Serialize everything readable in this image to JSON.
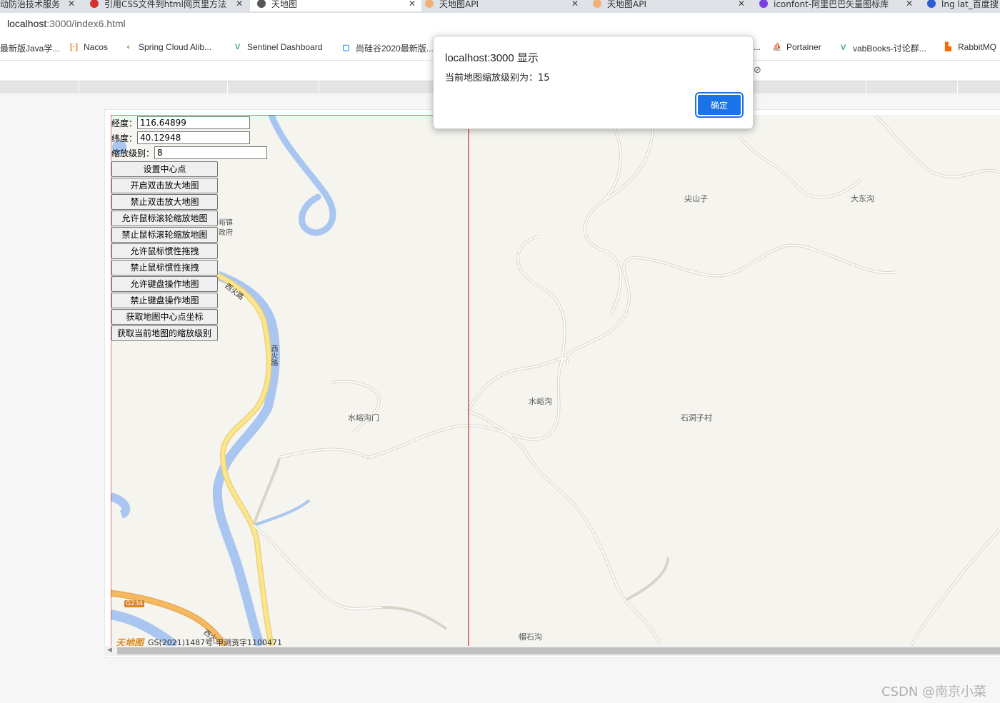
{
  "browser": {
    "tabs": [
      {
        "title": "动防治技术服务",
        "active": false,
        "color": "#c0392b"
      },
      {
        "title": "引用CSS文件到html网页里方法",
        "active": false,
        "color": "#d63031"
      },
      {
        "title": "天地图",
        "active": true,
        "color": "#555555"
      },
      {
        "title": "天地图API",
        "active": false,
        "color": "#e67e22"
      },
      {
        "title": "天地图API",
        "active": false,
        "color": "#e67e22"
      },
      {
        "title": "iconfont-阿里巴巴矢量图标库",
        "active": false,
        "color": "#7b3fe4"
      },
      {
        "title": "lng lat_百度搜",
        "active": false,
        "color": "#2d5bd7"
      }
    ],
    "url_host": "localhost",
    "url_path": ":3000/index6.html",
    "bookmarks": [
      {
        "label": "最新版Java学...",
        "icon": "",
        "color": "#888"
      },
      {
        "label": "Nacos",
        "icon": "[·]",
        "color": "#e67e22"
      },
      {
        "label": "Spring Cloud Alib...",
        "icon": "◐",
        "color": "#6db33f"
      },
      {
        "label": "Sentinel Dashboard",
        "icon": "V",
        "color": "#3aa876"
      },
      {
        "label": "尚硅谷2020最新版...",
        "icon": "▢",
        "color": "#1e90ff"
      },
      {
        "label": "...",
        "icon": "",
        "color": "#888"
      },
      {
        "label": "Portainer",
        "icon": "⛵",
        "color": "#13bef9"
      },
      {
        "label": "vabBooks-讨论群...",
        "icon": "V",
        "color": "#3aa876"
      },
      {
        "label": "RabbitMQ",
        "icon": "▙",
        "color": "#ff6600"
      }
    ]
  },
  "controls": {
    "lng_label": "经度：",
    "lng_value": "116.64899",
    "lat_label": "纬度：",
    "lat_value": "40.12948",
    "zoom_label": "缩放级别：",
    "zoom_value": "8",
    "buttons": [
      "设置中心点",
      "开启双击放大地图",
      "禁止双击放大地图",
      "允许鼠标滚轮缩放地图",
      "禁止鼠标滚轮缩放地图",
      "允许鼠标惯性拖拽",
      "禁止鼠标惯性拖拽",
      "允许键盘操作地图",
      "禁止键盘操作地图",
      "获取地图中心点坐标",
      "获取当前地图的缩放级别"
    ]
  },
  "map": {
    "places": {
      "jianshanzi": "尖山子",
      "dadonggou": "大东沟",
      "shuiyugou": "水峪沟",
      "shidongzicun": "石洞子村",
      "shuiyugoumen": "水峪沟门",
      "maoshigou": "帽石沟",
      "town_partial_1": "峪镇",
      "town_partial_2": "政府"
    },
    "roads": {
      "xihuo_1": "西火路",
      "xihuo_2": "西火路",
      "g234": "G234",
      "xihuo_3": "西火"
    },
    "copyright_logo": "天地图",
    "copyright_text": "GS(2021)1487号-甲测资字1100471",
    "colors": {
      "river": "#a8c6f0",
      "road_main": "#fce58c",
      "road_national": "#f5b961",
      "land": "#f5f4ef"
    }
  },
  "dialog": {
    "title": "localhost:3000 显示",
    "message": "当前地图缩放级别为：15",
    "ok_label": "确定"
  },
  "watermark": "CSDN @南京小菜"
}
